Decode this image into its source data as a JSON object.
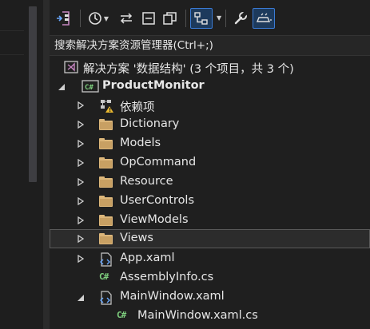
{
  "colors": {
    "background": "#1f1f1f",
    "selection_border": "#5a5a5a",
    "folder": "#dcb67a",
    "csharp": "#7fd07f",
    "accent": "#3a7bd5"
  },
  "toolbar": {
    "buttons": [
      {
        "icon": "sync-with-active-document-icon"
      },
      {
        "icon": "pending-changes-filter-icon"
      },
      {
        "icon": "sync-arrows-icon"
      },
      {
        "icon": "collapse-all-icon"
      },
      {
        "icon": "show-all-files-icon"
      },
      {
        "icon": "switch-views-icon",
        "active": true
      },
      {
        "icon": "properties-wrench-icon"
      },
      {
        "icon": "preview-selected-items-icon",
        "active": true
      }
    ]
  },
  "search": {
    "placeholder": "搜索解决方案资源管理器(Ctrl+;)"
  },
  "tree": {
    "solution": {
      "label": "解决方案 '数据结构' (3 个项目，共 3 个)",
      "icon": "solution-icon"
    },
    "project": {
      "label": "ProductMonitor",
      "icon": "csharp-project-icon",
      "expanded": true
    },
    "items": [
      {
        "label": "依赖项",
        "icon": "dependencies-icon",
        "expandable": true
      },
      {
        "label": "Dictionary",
        "icon": "folder-icon",
        "expandable": true
      },
      {
        "label": "Models",
        "icon": "folder-icon",
        "expandable": true
      },
      {
        "label": "OpCommand",
        "icon": "folder-icon",
        "expandable": true
      },
      {
        "label": "Resource",
        "icon": "folder-icon",
        "expandable": true
      },
      {
        "label": "UserControls",
        "icon": "folder-icon",
        "expandable": true
      },
      {
        "label": "ViewModels",
        "icon": "folder-icon",
        "expandable": true
      },
      {
        "label": "Views",
        "icon": "folder-icon",
        "expandable": true,
        "selected": true
      },
      {
        "label": "App.xaml",
        "icon": "xaml-file-icon",
        "expandable": true
      },
      {
        "label": "AssemblyInfo.cs",
        "icon": "csharp-file-icon",
        "expandable": false
      },
      {
        "label": "MainWindow.xaml",
        "icon": "xaml-file-icon",
        "expandable": true,
        "expanded": true
      },
      {
        "label": "MainWindow.xaml.cs",
        "icon": "csharp-file-icon",
        "expandable": false
      }
    ]
  }
}
